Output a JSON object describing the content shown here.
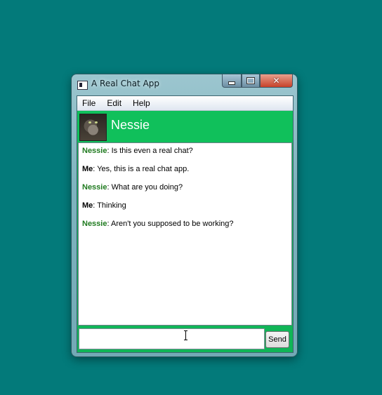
{
  "window": {
    "title": "A Real Chat App"
  },
  "menu": {
    "items": [
      {
        "label": "File"
      },
      {
        "label": "Edit"
      },
      {
        "label": "Help"
      }
    ]
  },
  "header": {
    "contact_name": "Nessie",
    "accent_color": "#10c05b"
  },
  "messages": [
    {
      "sender": "Nessie",
      "text": ": Is this even a real chat?"
    },
    {
      "sender": "Me",
      "text": ": Yes, this is a real chat app."
    },
    {
      "sender": "Nessie",
      "text": ": What are you doing?"
    },
    {
      "sender": "Me",
      "text": ": Thinking"
    },
    {
      "sender": "Nessie",
      "text": ": Aren't you supposed to be working?"
    }
  ],
  "composer": {
    "value": "",
    "send_label": "Send"
  },
  "icons": [
    "app-icon",
    "minimize-icon",
    "maximize-icon",
    "close-icon",
    "avatar"
  ]
}
